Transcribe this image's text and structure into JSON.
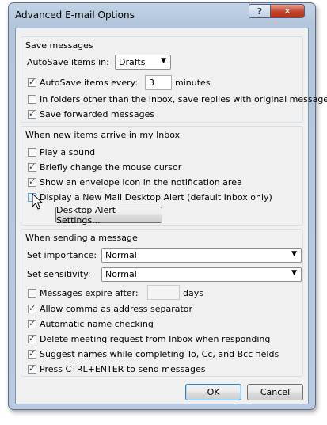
{
  "window": {
    "title": "Advanced E-mail Options",
    "help_glyph": "?",
    "close_glyph": "✕"
  },
  "save_messages": {
    "group_label": "Save messages",
    "autosave_label": "AutoSave items in:",
    "autosave_folder": "Drafts",
    "autosave_every_label": "AutoSave items every:",
    "autosave_every_checked": true,
    "autosave_minutes": "3",
    "minutes_label": "minutes",
    "in_folders_label": "In folders other than the Inbox, save replies with original message",
    "in_folders_checked": false,
    "save_forwarded_label": "Save forwarded messages",
    "save_forwarded_checked": true
  },
  "new_items": {
    "group_label": "When new items arrive in my Inbox",
    "play_sound_label": "Play a sound",
    "play_sound_checked": false,
    "change_cursor_label": "Briefly change the mouse cursor",
    "change_cursor_checked": true,
    "envelope_label": "Show an envelope icon in the notification area",
    "envelope_checked": true,
    "desktop_alert_label": "Display a New Mail Desktop Alert (default Inbox only)",
    "desktop_alert_checked": false,
    "alert_settings_button": "Desktop Alert Settings..."
  },
  "sending": {
    "group_label": "When sending a message",
    "importance_label": "Set importance:",
    "importance_value": "Normal",
    "sensitivity_label": "Set sensitivity:",
    "sensitivity_value": "Normal",
    "expire_label": "Messages expire after:",
    "expire_checked": false,
    "expire_value": "",
    "days_label": "days",
    "comma_label": "Allow comma as address separator",
    "comma_checked": true,
    "auto_name_label": "Automatic name checking",
    "auto_name_checked": true,
    "delete_meeting_label": "Delete meeting request from Inbox when responding",
    "delete_meeting_checked": true,
    "suggest_names_label": "Suggest names while completing To, Cc, and Bcc fields",
    "suggest_names_checked": true,
    "ctrl_enter_label": "Press CTRL+ENTER to send messages",
    "ctrl_enter_checked": true
  },
  "buttons": {
    "ok": "OK",
    "cancel": "Cancel"
  },
  "icons": {
    "check": "check-icon",
    "dropdown": "chevron-down-icon",
    "cursor": "mouse-pointer-icon"
  }
}
